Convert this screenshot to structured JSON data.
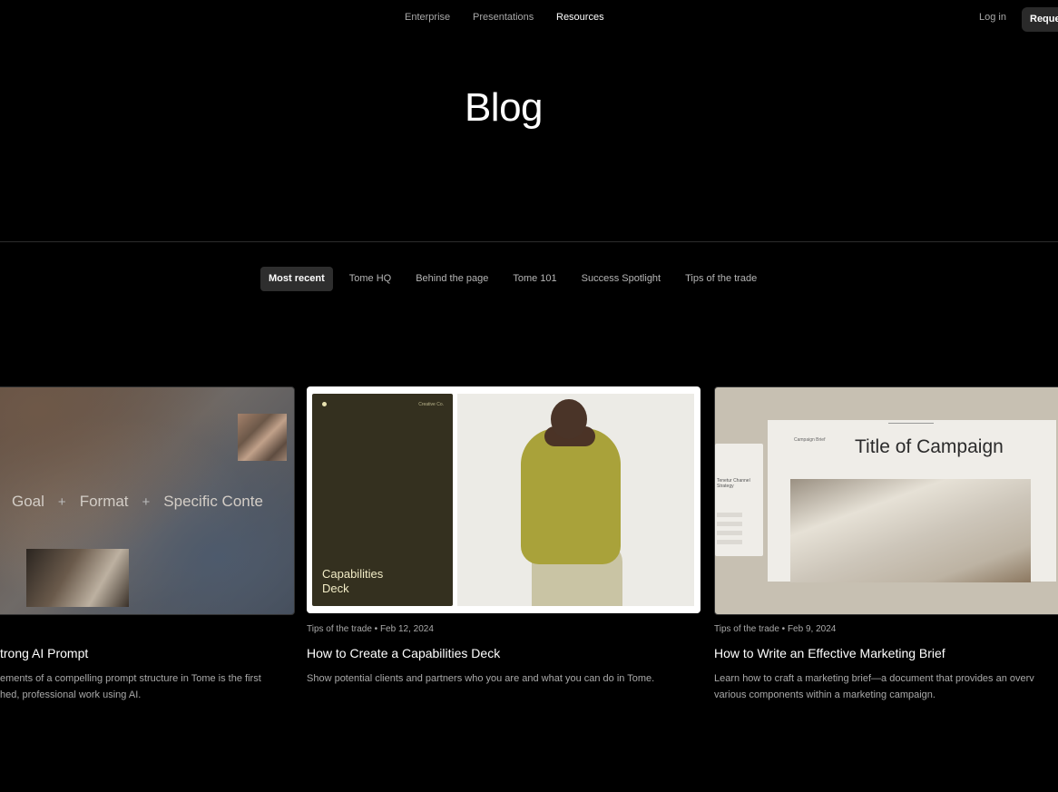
{
  "nav": {
    "links": [
      "Enterprise",
      "Presentations",
      "Resources"
    ],
    "active": "Resources",
    "login": "Log in",
    "request": "Reque"
  },
  "page": {
    "title": "Blog"
  },
  "filters": [
    "Most recent",
    "Tome HQ",
    "Behind the page",
    "Tome 101",
    "Success Spotlight",
    "Tips of the trade"
  ],
  "posts": [
    {
      "title": "trong AI Prompt",
      "description_lines": [
        "ements of a compelling prompt structure in Tome is the first",
        "hed, professional work using AI."
      ],
      "image": {
        "prompt_parts": [
          "Goal",
          "Format",
          "Specific Conte"
        ],
        "separator": "+"
      }
    },
    {
      "meta": "Tips of the trade • Feb 12, 2024",
      "title": "How to Create a Capabilities Deck",
      "description_lines": [
        "Show potential clients and partners who you are and what you can do in Tome."
      ],
      "image": {
        "deck_title": "Capabilities Deck",
        "deck_small_label": "Creative Co."
      }
    },
    {
      "meta": "Tips of the trade • Feb 9, 2024",
      "title": "How to Write an Effective Marketing Brief",
      "description_lines": [
        "Learn how to craft a marketing brief—a document that provides an overv",
        "various components within a marketing campaign."
      ],
      "image": {
        "slide_title": "Title of Campaign",
        "slide_small_label": "Campaign Brief",
        "panel_text": "Tenetur Channel Strategy"
      }
    }
  ]
}
